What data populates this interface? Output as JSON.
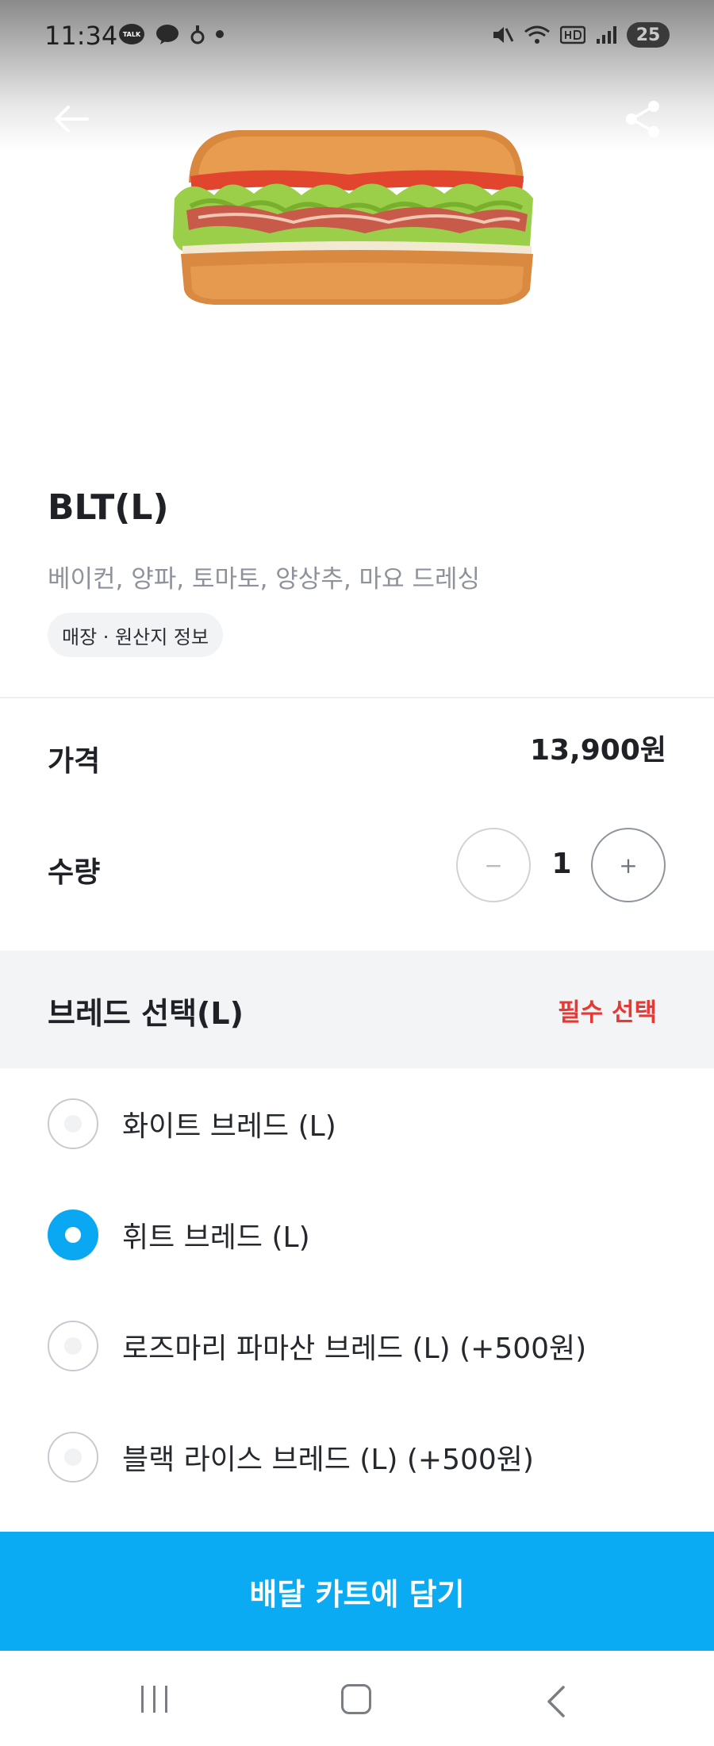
{
  "status_bar": {
    "time": "11:34",
    "talk_icon_text": "TALK",
    "battery_level": "25"
  },
  "product": {
    "title": "BLT(L)",
    "description": "베이컨, 양파, 토마토, 양상추, 마요 드레싱",
    "origin_chip": "매장 · 원산지 정보"
  },
  "price": {
    "label": "가격",
    "value": "13,900원"
  },
  "quantity": {
    "label": "수량",
    "minus": "−",
    "value": "1",
    "plus": "+"
  },
  "bread_section": {
    "title": "브레드 선택(L)",
    "badge": "필수 선택",
    "options": [
      {
        "label": "화이트 브레드 (L)",
        "selected": false
      },
      {
        "label": "휘트 브레드 (L)",
        "selected": true
      },
      {
        "label": "로즈마리 파마산 브레드 (L) (+500원)",
        "selected": false
      },
      {
        "label": "블랙 라이스 브레드 (L) (+500원)",
        "selected": false
      }
    ]
  },
  "cta": {
    "label": "배달 카트에 담기"
  },
  "colors": {
    "accent": "#0aabf2",
    "required": "#e53935"
  }
}
